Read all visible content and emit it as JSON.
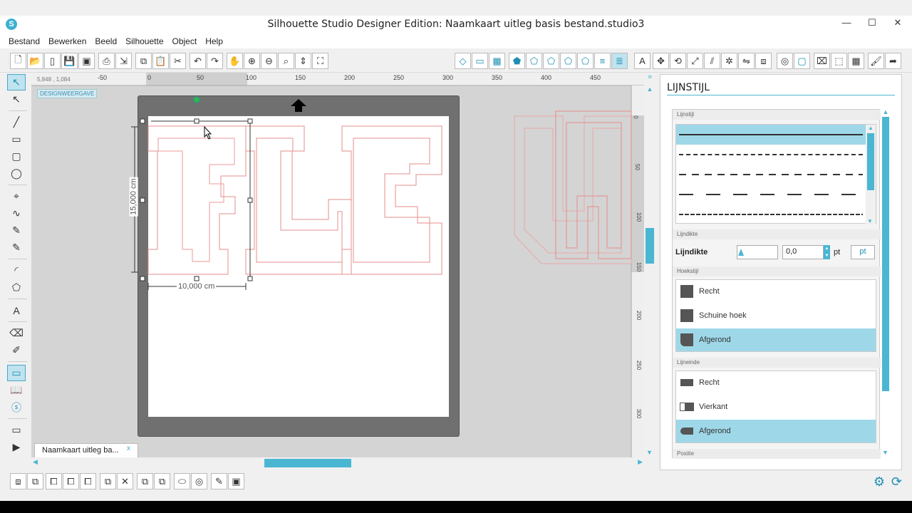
{
  "window": {
    "title": "Silhouette Studio Designer Edition: Naamkaart uitleg basis bestand.studio3",
    "minimize": "—",
    "maximize": "☐",
    "close": "✕"
  },
  "menu": [
    "Bestand",
    "Bewerken",
    "Beeld",
    "Silhouette",
    "Object",
    "Help"
  ],
  "status": {
    "coordinates": "5,848 , 1,084",
    "view_label": "DESIGNWEERGAVE"
  },
  "ruler": {
    "h_ticks": [
      "-50",
      "0",
      "50",
      "100",
      "150",
      "200",
      "250",
      "300",
      "350",
      "400",
      "450"
    ],
    "v_ticks": [
      "0",
      "50",
      "100",
      "150",
      "200",
      "250",
      "300"
    ]
  },
  "canvas": {
    "width_label": "10,000 cm",
    "height_label": "15,000 cm",
    "letters_visible": "FLE",
    "right_letters": "UR"
  },
  "doc_tab": {
    "label": "Naamkaart uitleg ba...",
    "close": "x"
  },
  "panel": {
    "title": "LIJNSTIJL",
    "sections": {
      "linestyle": "Lijnstijl",
      "linewidth": "Lijndikte",
      "corner": "Hoekstijl",
      "end": "Lijneinde",
      "position": "Positie"
    },
    "linewidth_label": "Lijndikte",
    "linewidth_value": "0,0",
    "linewidth_unit": "pt",
    "linewidth_unit_btn": "pt",
    "corner_options": [
      {
        "label": "Recht",
        "selected": false
      },
      {
        "label": "Schuine hoek",
        "selected": false
      },
      {
        "label": "Afgerond",
        "selected": true
      }
    ],
    "end_options": [
      {
        "label": "Recht",
        "selected": false
      },
      {
        "label": "Vierkant",
        "selected": false
      },
      {
        "label": "Afgerond",
        "selected": true
      }
    ]
  },
  "colors": {
    "accent": "#4ab6d2",
    "selected_row": "#9ed8e8",
    "cut_line": "#e58c8c"
  }
}
